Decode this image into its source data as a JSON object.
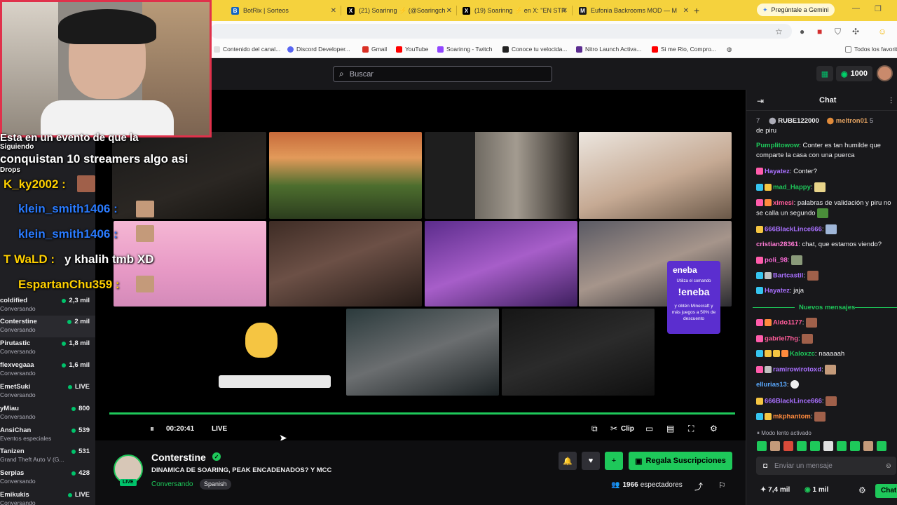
{
  "browser": {
    "tabs": [
      {
        "title": "BotRix | Sorteos",
        "color": "#1565c0"
      },
      {
        "title": "(21) Soarinng ⚡ (@Soaringch",
        "color": "#000000"
      },
      {
        "title": "(19) Soarinng ⚡ en X: \"EN STR",
        "color": "#000000"
      },
      {
        "title": "Eufonia Backrooms MOD — M",
        "color": "#1a1a1a"
      }
    ],
    "new_tab": "+",
    "gemini": "Pregúntale a Gemini",
    "bookmarks": [
      {
        "label": "Contenido del canal...",
        "color": "#e0e0e0"
      },
      {
        "label": "Discord Developer...",
        "color": "#5865f2"
      },
      {
        "label": "Gmail",
        "color": "#d93025"
      },
      {
        "label": "YouTube",
        "color": "#ff0000"
      },
      {
        "label": "Soarinng - Twitch",
        "color": "#9146ff"
      },
      {
        "label": "Conoce tu velocida...",
        "color": "#222222"
      },
      {
        "label": "Nitro Launch Activa...",
        "color": "#5c2d91"
      },
      {
        "label": "Si me Rio, Compro...",
        "color": "#ff0000"
      },
      {
        "label": "Todos los favoritos",
        "color": "#888888"
      }
    ]
  },
  "topnav": {
    "search_placeholder": "Buscar",
    "coins": "1000"
  },
  "sidebar": {
    "channels": [
      {
        "name": "coldified",
        "game": "Conversando",
        "count": "2,3 mil"
      },
      {
        "name": "Conterstine",
        "game": "Conversando",
        "count": "2 mil"
      },
      {
        "name": "Pirutastic",
        "game": "Conversando",
        "count": "1,8 mil"
      },
      {
        "name": "flexvegaaa",
        "game": "Conversando",
        "count": "1,6 mil"
      },
      {
        "name": "EmetSuki",
        "game": "Conversando",
        "count": "LIVE"
      },
      {
        "name": "yMiau",
        "game": "Conversando",
        "count": "800"
      },
      {
        "name": "AnsiChan",
        "game": "Eventos especiales",
        "count": "539"
      },
      {
        "name": "Tanizen",
        "game": "Grand Theft Auto V (G...",
        "count": "531"
      },
      {
        "name": "Serpias",
        "game": "Conversando",
        "count": "428"
      },
      {
        "name": "Emikukis",
        "game": "Conversando",
        "count": "LIVE"
      }
    ]
  },
  "player": {
    "time": "00:20:41",
    "live": "LIVE",
    "clip": "Clip"
  },
  "stream": {
    "streamer": "Conterstine",
    "title": "DINAMICA DE SOARING, PEAK ENCADENADOS? Y MCC",
    "category": "Conversando",
    "language": "Spanish",
    "live_tag": "LIVE",
    "subscribe": "Regala Suscripciones",
    "viewers": "1966",
    "viewers_label": "espectadores"
  },
  "chat": {
    "title": "Chat",
    "top_count": "7",
    "top_user1": "RUBE122000",
    "top_user1_count": "5",
    "top_user2": "meltron01",
    "top_user2_count": "5",
    "pinned_fragment": "de piru",
    "messages": [
      {
        "user": "Pumplitowow",
        "text": "Conter es tan humilde que comparte la casa con una puerca",
        "color": "#1ec85a"
      },
      {
        "user": "Hayatez",
        "text": "Conter?",
        "color": "#a970ff"
      },
      {
        "user": "mad_Happy",
        "text": "",
        "color": "#1ec85a"
      },
      {
        "user": "ximesi",
        "text": "palabras de validación y piru no se calla un segundo",
        "color": "#ff5c9a"
      },
      {
        "user": "666BlackLince666",
        "text": "",
        "color": "#a970ff"
      },
      {
        "user": "cristian28361",
        "text": "chat, que estamos viendo?",
        "color": "#ff7bd5"
      },
      {
        "user": "poli_98",
        "text": "",
        "color": "#ff6bd9"
      },
      {
        "user": "Bartcastil",
        "text": "",
        "color": "#a970ff"
      },
      {
        "user": "Hayatez",
        "text": "jaja",
        "color": "#a970ff"
      }
    ],
    "new_messages": "Nuevos mensajes",
    "new": [
      {
        "user": "Aldo1177",
        "text": "",
        "color": "#ff5c9a"
      },
      {
        "user": "gabriel7hg",
        "text": "",
        "color": "#ff5c9a"
      },
      {
        "user": "Kaloxzc",
        "text": "naaaaah",
        "color": "#1ec85a"
      },
      {
        "user": "ramirowirotoxd",
        "text": "",
        "color": "#a970ff"
      },
      {
        "user": "ellurias13",
        "text": "",
        "color": "#5aa9ff"
      },
      {
        "user": "666BlackLince666",
        "text": "",
        "color": "#a970ff"
      },
      {
        "user": "mkphantom",
        "text": "",
        "color": "#ff8a3d"
      }
    ],
    "slow_mode": "Modo lento activado",
    "input_placeholder": "Enviar un mensaje",
    "points": "7,4 mil",
    "coins": "1 mil",
    "send": "Chat"
  },
  "overlay": {
    "line1": "Esta en un evento de que la",
    "line2": "conquistan 10 streamers algo asi",
    "siguiendo": "Siguiendo",
    "drops": "Drops",
    "ky_user": "K_ky2002 :",
    "klein1": "klein_smith1406 :",
    "klein2": "klein_smith1406 :",
    "wald_user": "T WaLD :",
    "wald_text": "y khalih tmb XD",
    "espartan": "EspartanChu359 :",
    "eneba_title": "eneba",
    "eneba_cmd": "!eneba",
    "eneba_text": "y obtén Minecraft y más juegos a 50% de descuento",
    "eneba_sub": "Utiliza el comando"
  }
}
